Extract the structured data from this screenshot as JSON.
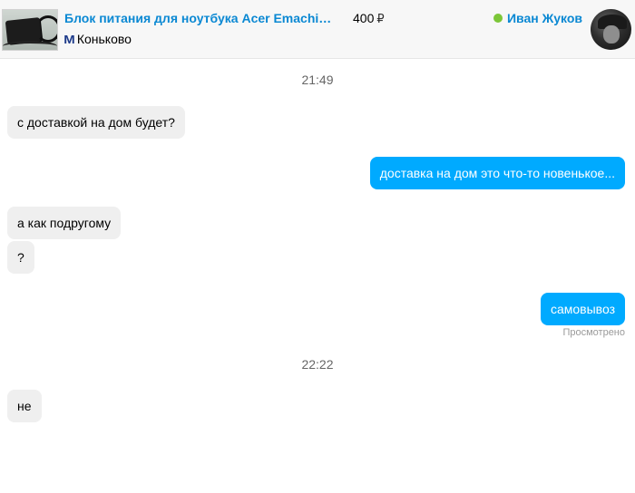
{
  "header": {
    "ad_title": "Блок питания для ноутбука Acer Emachines ...",
    "price": "400",
    "currency": "₽",
    "metro_icon": "М",
    "metro_station": "Коньково",
    "user_name": "Иван Жуков",
    "user_online": true,
    "thumbnail": "laptop-charger-photo",
    "avatar": "user-avatar-photo"
  },
  "messages": [
    {
      "type": "time",
      "text": "21:49"
    },
    {
      "type": "in",
      "text": "с доставкой на дом будет?"
    },
    {
      "type": "out",
      "text": "доставка на дом это что-то новенькое..."
    },
    {
      "type": "in",
      "text": "а как подругому"
    },
    {
      "type": "in",
      "text": "?"
    },
    {
      "type": "out",
      "text": "самовывоз"
    },
    {
      "type": "status",
      "text": "Просмотрено"
    },
    {
      "type": "time",
      "text": "22:22"
    },
    {
      "type": "in",
      "text": "не"
    }
  ],
  "colors": {
    "accent": "#0a88d3",
    "outgoing_bubble": "#00aaff",
    "incoming_bubble": "#efefef",
    "online": "#7cc638"
  }
}
